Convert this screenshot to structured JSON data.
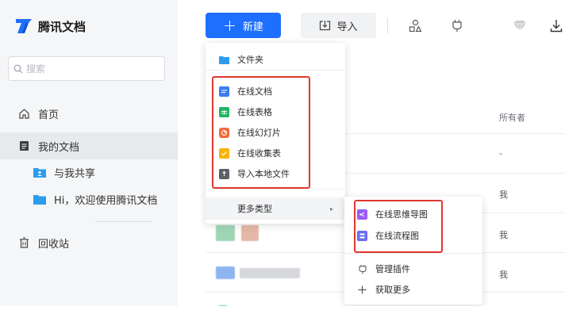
{
  "app": {
    "name": "腾讯文档",
    "brand_color": "#1e6fff"
  },
  "search": {
    "placeholder": "搜索"
  },
  "sidebar": {
    "items": [
      {
        "label": "首页",
        "icon": "home-icon"
      },
      {
        "label": "我的文档",
        "icon": "document-icon",
        "active": true
      },
      {
        "label": "与我共享",
        "icon": "shared-folder-icon"
      },
      {
        "label": "Hi，欢迎使用腾讯文档",
        "icon": "folder-icon"
      },
      {
        "label": "回收站",
        "icon": "trash-icon"
      }
    ]
  },
  "toolbar": {
    "new_label": "新建",
    "import_label": "导入",
    "icons": [
      "shapes-icon",
      "plugin-icon",
      "diamond-icon",
      "download-icon"
    ]
  },
  "table": {
    "owner_header": "所有者",
    "owners": [
      "-",
      "我",
      "我",
      "我"
    ]
  },
  "new_menu": {
    "items": [
      {
        "label": "文件夹",
        "icon": "folder-icon",
        "color": "#2d9cf0"
      },
      {
        "label": "在线文档",
        "icon": "doc-icon",
        "color": "#3a7cf4"
      },
      {
        "label": "在线表格",
        "icon": "sheet-icon",
        "color": "#25b468"
      },
      {
        "label": "在线幻灯片",
        "icon": "slides-icon",
        "color": "#f26a3d"
      },
      {
        "label": "在线收集表",
        "icon": "form-icon",
        "color": "#f6b400"
      },
      {
        "label": "导入本地文件",
        "icon": "import-file-icon",
        "color": "#5b5f66"
      },
      {
        "label": "更多类型",
        "icon": "chevron-right-icon"
      }
    ]
  },
  "more_menu": {
    "items": [
      {
        "label": "在线思维导图",
        "icon": "mindmap-icon",
        "color": "#9a5cf2"
      },
      {
        "label": "在线流程图",
        "icon": "flowchart-icon",
        "color": "#6b6cf4"
      },
      {
        "label": "管理插件",
        "icon": "plugin-icon"
      },
      {
        "label": "获取更多",
        "icon": "plus-icon"
      }
    ]
  },
  "highlight_color": "#e0382e"
}
